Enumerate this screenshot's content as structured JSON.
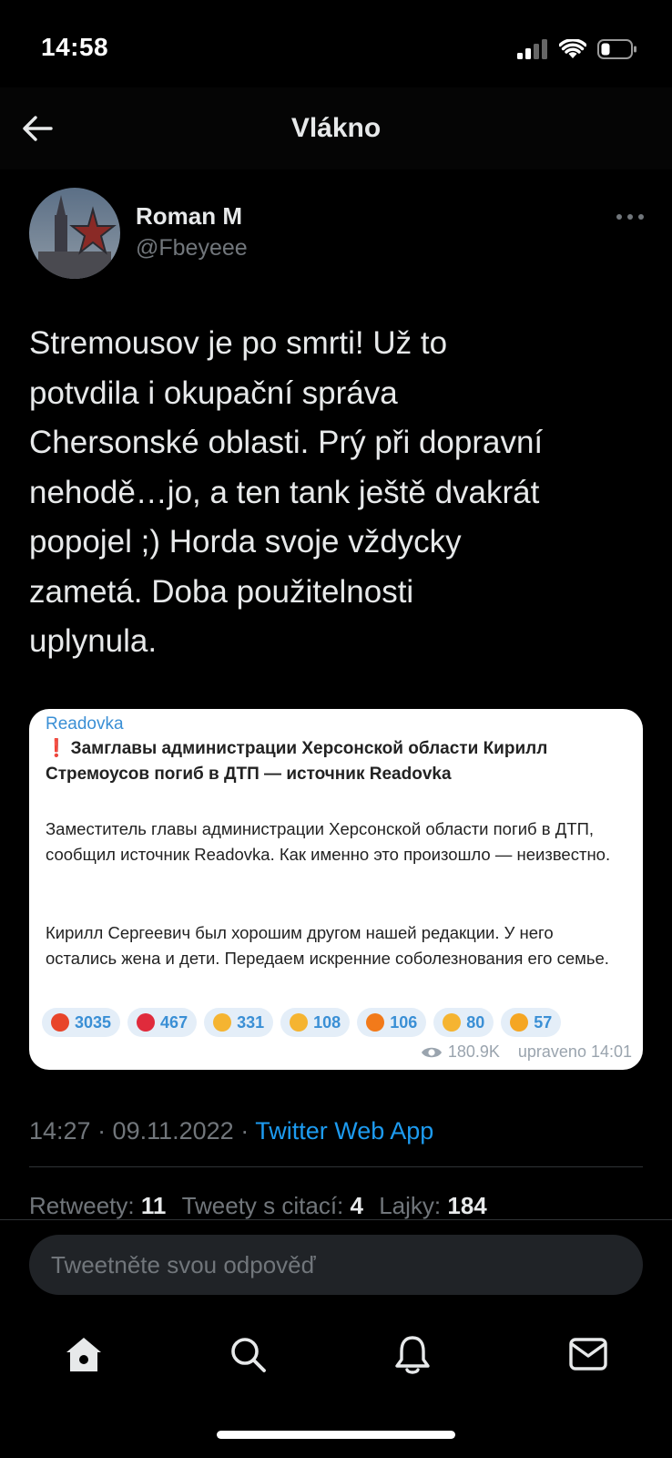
{
  "status_bar": {
    "time": "14:58"
  },
  "header": {
    "title": "Vlákno"
  },
  "author": {
    "name": "Roman M",
    "handle": "@Fbeyeee"
  },
  "tweet": {
    "text": "Stremousov je po smrti! Už to\npotvdila i okupační správa\nChersonské oblasti. Prý při dopravní\nnehodě…jo, a ten tank ještě dvakrát\npopojel ;) Horda svoje vždycky\nzametá.  Doba použitelnosti\nuplynula."
  },
  "media": {
    "source": "Readovka",
    "headline_mark": "❗",
    "headline": "Замглавы администрации Херсонской области Кирилл Стремоусов погиб в ДТП — источник Readovka",
    "paragraph1": "Заместитель главы администрации Херсонской области погиб в ДТП, сообщил источник Readovka. Как именно это произошло — неизвестно.",
    "paragraph2": "Кирилл Сергеевич был хорошим другом нашей редакции. У него остались жена и дети. Передаем искренние соболезнования его семье.",
    "reactions": [
      {
        "icon": "angry-face-icon",
        "count": "3035",
        "color": "#e8452a"
      },
      {
        "icon": "heart-icon",
        "count": "467",
        "color": "#e02b3c"
      },
      {
        "icon": "thumbs-up-icon",
        "count": "331",
        "color": "#f5b431"
      },
      {
        "icon": "thumbs-down-icon",
        "count": "108",
        "color": "#f5b431"
      },
      {
        "icon": "fire-icon",
        "count": "106",
        "color": "#f27a1a"
      },
      {
        "icon": "clapping-hands-icon",
        "count": "80",
        "color": "#f5b431"
      },
      {
        "icon": "smiling-face-hearts-icon",
        "count": "57",
        "color": "#f5a623"
      }
    ],
    "views": "180.9K",
    "edited": "upraveno 14:01"
  },
  "meta": {
    "time_date": "14:27 · 09.11.2022 · ",
    "app": "Twitter Web App"
  },
  "stats": {
    "retweets_label": "Retweety: ",
    "retweets": "11",
    "quotes_label": "Tweety s citací: ",
    "quotes": "4",
    "likes_label": "Lajky: ",
    "likes": "184"
  },
  "reply": {
    "placeholder": "Tweetněte svou odpověď"
  },
  "colors": {
    "accent": "#1d9bf0",
    "background": "#000000",
    "muted": "#71767b"
  }
}
